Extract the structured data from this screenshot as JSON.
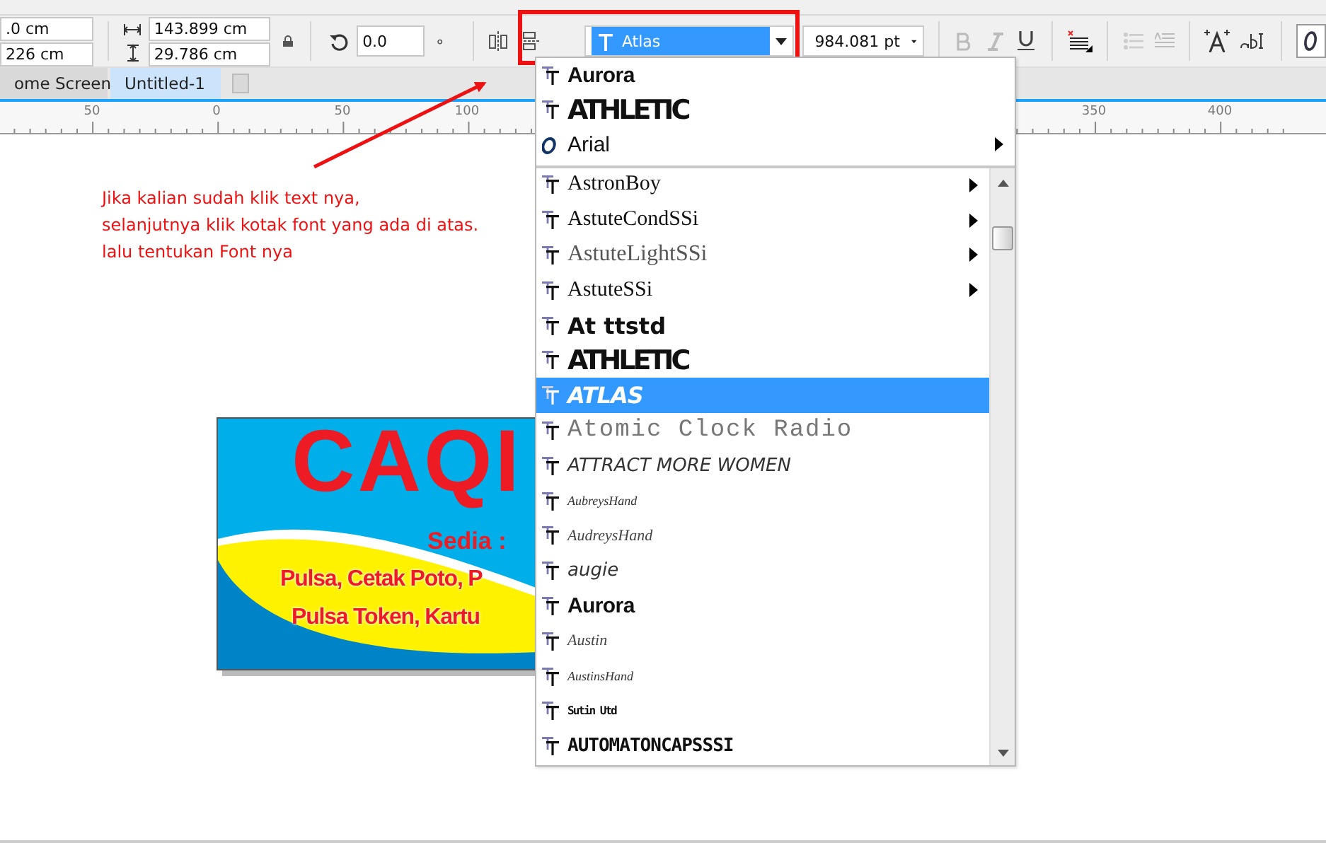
{
  "property_bar": {
    "position_x": ".0 cm",
    "position_y": "226 cm",
    "width": "143.899 cm",
    "height": "29.786 cm",
    "angle": "0.0",
    "angle_unit": "°",
    "font": "Atlas",
    "font_size": "984.081 pt"
  },
  "tabs": [
    {
      "label": "ome Screen",
      "selected": false
    },
    {
      "label": "Untitled-1",
      "selected": true
    }
  ],
  "ruler_labels": [
    "50",
    "0",
    "50",
    "100",
    "350",
    "400"
  ],
  "annotation": "Jika kalian sudah klik text nya,\nselanjutnya klik kotak font yang ada di atas.\nlalu tentukan Font nya",
  "banner": {
    "title": "CAQI",
    "subtitle": "Sedia :",
    "lines": [
      "Pulsa, Cetak Poto, P",
      "Pulsa Token, Kartu"
    ]
  },
  "font_menu": {
    "recent": [
      {
        "name": "Aurora",
        "kind": "heavy",
        "submenu": false,
        "selected": false
      },
      {
        "name": "ATHLETIC",
        "kind": "athletic",
        "submenu": false,
        "selected": false
      },
      {
        "name": "Arial",
        "kind": "sans",
        "submenu": true,
        "selected": false
      }
    ],
    "fonts": [
      {
        "name": "AstronBoy",
        "kind": "serif",
        "submenu": true,
        "selected": false
      },
      {
        "name": "AstuteCondSSi",
        "kind": "serif",
        "submenu": true,
        "selected": false
      },
      {
        "name": "AstuteLightSSi",
        "kind": "light-serif",
        "submenu": true,
        "selected": false
      },
      {
        "name": "AstuteSSi",
        "kind": "serif",
        "submenu": true,
        "selected": false
      },
      {
        "name": "At ttstd",
        "kind": "wide",
        "submenu": false,
        "selected": false
      },
      {
        "name": "ATHLETIC",
        "kind": "athletic",
        "submenu": false,
        "selected": false
      },
      {
        "name": "ATLAS",
        "kind": "atlas",
        "submenu": false,
        "selected": true
      },
      {
        "name": "Atomic Clock Radio",
        "kind": "dotted",
        "submenu": false,
        "selected": false
      },
      {
        "name": "ATTRACT MORE WOMEN",
        "kind": "handwriting",
        "submenu": false,
        "selected": false
      },
      {
        "name": "AubreysHand",
        "kind": "tiny-script",
        "submenu": false,
        "selected": false
      },
      {
        "name": "AudreysHand",
        "kind": "script",
        "submenu": false,
        "selected": false
      },
      {
        "name": "augie",
        "kind": "handwriting",
        "submenu": false,
        "selected": false
      },
      {
        "name": "Aurora",
        "kind": "heavy",
        "submenu": false,
        "selected": false
      },
      {
        "name": "Austin",
        "kind": "script",
        "submenu": false,
        "selected": false
      },
      {
        "name": "AustinsHand",
        "kind": "tiny-script",
        "submenu": false,
        "selected": false
      },
      {
        "name": "Sutin Utd",
        "kind": "tiny-condensed",
        "submenu": false,
        "selected": false
      },
      {
        "name": "AUTOMATONCAPSSSI",
        "kind": "condensed",
        "submenu": false,
        "selected": false
      }
    ]
  }
}
